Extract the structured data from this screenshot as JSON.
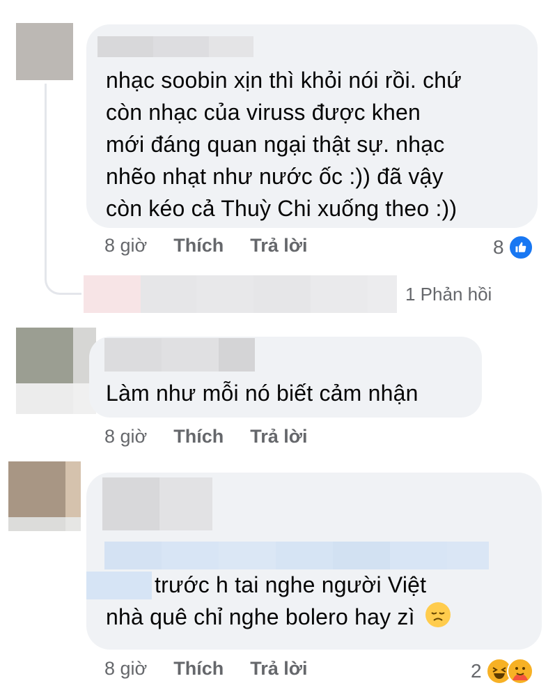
{
  "comments": [
    {
      "text_lines": [
        "nhạc soobin xịn thì khỏi nói rồi. chứ",
        "còn nhạc của viruss được khen",
        "mới đáng quan ngại thật sự. nhạc",
        "nhẽo nhạt như nước ốc :)) đã vậy",
        "còn kéo cả Thuỳ Chi xuống theo :))"
      ],
      "time": "8 giờ",
      "like_label": "Thích",
      "reply_label": "Trả lời",
      "reaction_count": "8",
      "reaction_icons": [
        "like-icon"
      ],
      "replies_label": "1 Phản hồi"
    },
    {
      "text_lines": [
        "Làm như mỗi nó biết cảm nhận"
      ],
      "time": "8 giờ",
      "like_label": "Thích",
      "reply_label": "Trả lời"
    },
    {
      "text_lines": [
        "trước h tai nghe người Việt",
        "nhà quê chỉ nghe bolero hay zì"
      ],
      "trailing_emoji": "😞",
      "time": "8 giờ",
      "like_label": "Thích",
      "reply_label": "Trả lời",
      "reaction_count": "2",
      "reaction_icons": [
        "haha-icon",
        "care-icon"
      ]
    }
  ],
  "colors": {
    "bubble": "#f0f2f5",
    "meta_text": "#65676b",
    "like_blue": "#1877f2",
    "mention_blur": "#d6e4f5"
  }
}
